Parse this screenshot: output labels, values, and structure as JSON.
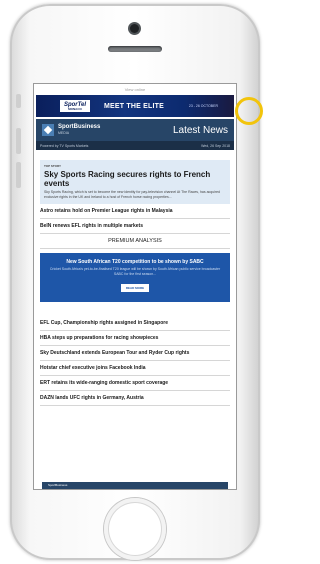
{
  "email": {
    "view_online": "View online",
    "ad": {
      "logo_main": "SporTel",
      "logo_sub": "MONACO",
      "tagline": "MEET THE ELITE",
      "cta": "23 - 26 OCTOBER"
    },
    "brand": {
      "name": "SportBusiness",
      "sub": "MEDIA",
      "section": "Latest News"
    },
    "subbar": {
      "left": "Powered by TV Sports Markets",
      "date": "Wed, 26 Sep 2018"
    },
    "top_story": {
      "tag": "TOP STORY",
      "title": "Sky Sports Racing secures rights to French events",
      "desc": "Sky Sports Racing, which is set to become the new identity for pay-television channel At The Races, has acquired exclusive rights in the UK and Ireland to a host of French horse racing properties..."
    },
    "news_top": [
      "Astro retains hold on Premier League rights in Malaysia",
      "BeIN renews EFL rights in multiple markets"
    ],
    "premium": {
      "heading": "PREMIUM ANALYSIS",
      "title": "New South African T20 competition to be shown by SABC",
      "desc": "Cricket South Africa's yet-to-be-finalised T20 league will be shown by South African public service broadcaster SABC for the first season...",
      "button": "READ MORE"
    },
    "news_bottom": [
      "EFL Cup, Championship rights assigned in Singapore",
      "HBA steps up preparations for racing showpieces",
      "Sky Deutschland extends European Tour and Ryder Cup rights",
      "Hotstar chief executive joins Facebook India",
      "ERT retains its wide-ranging domestic sport coverage",
      "DAZN lands UFC rights in Germany, Austria"
    ],
    "footer": "SportBusiness"
  }
}
